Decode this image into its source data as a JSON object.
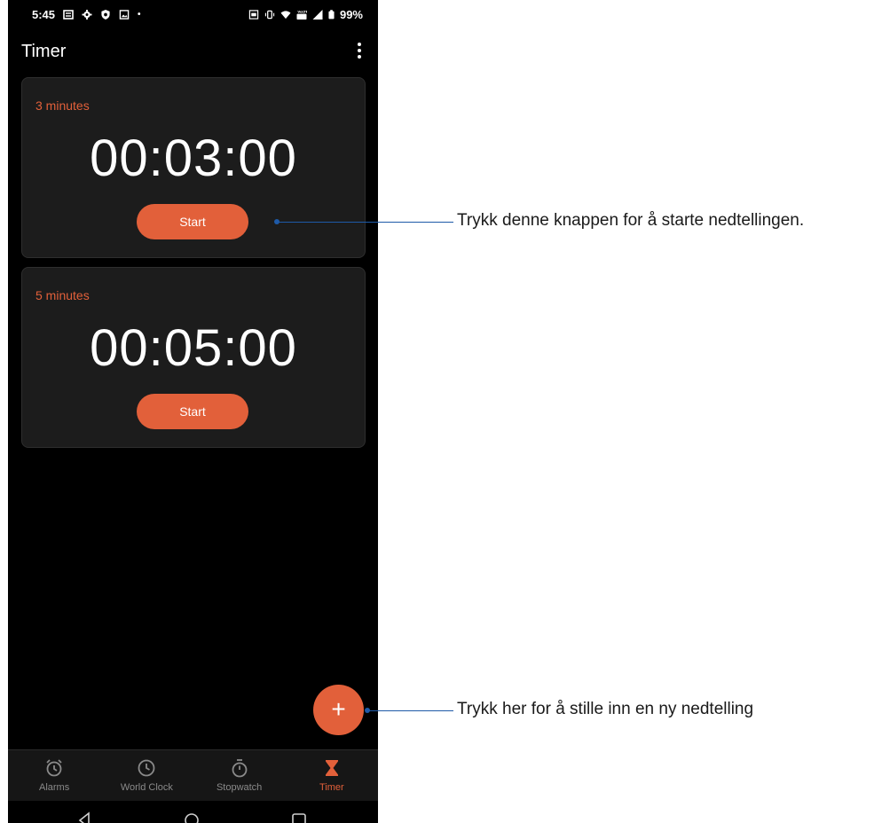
{
  "statusbar": {
    "time": "5:45",
    "battery": "99%"
  },
  "appbar": {
    "title": "Timer"
  },
  "timers": [
    {
      "label": "3 minutes",
      "time": "00:03:00",
      "button": "Start"
    },
    {
      "label": "5 minutes",
      "time": "00:05:00",
      "button": "Start"
    }
  ],
  "fab": {
    "label": "+"
  },
  "bottom_nav": [
    {
      "label": "Alarms",
      "icon": "alarm-icon"
    },
    {
      "label": "World Clock",
      "icon": "clock-icon"
    },
    {
      "label": "Stopwatch",
      "icon": "stopwatch-icon"
    },
    {
      "label": "Timer",
      "icon": "hourglass-icon",
      "active": true
    }
  ],
  "annotations": {
    "start": "Trykk denne knappen for å starte nedtellingen.",
    "add": "Trykk her for å stille inn en ny nedtelling"
  },
  "colors": {
    "accent": "#e2603a",
    "callout": "#1e5aa8",
    "background": "#000000",
    "card": "#1c1c1c"
  }
}
